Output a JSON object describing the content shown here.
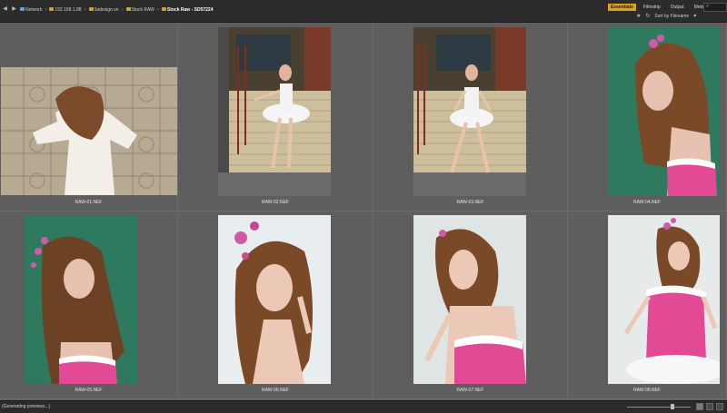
{
  "breadcrumb": {
    "items": [
      {
        "label": "Network",
        "icon": "network-icon"
      },
      {
        "label": "192.168.1.88",
        "icon": "folder-icon"
      },
      {
        "label": "3adesign.vn",
        "icon": "folder-icon"
      },
      {
        "label": "Stock RAW",
        "icon": "folder-icon"
      },
      {
        "label": "Stock Raw - SD57224",
        "icon": "folder-icon"
      }
    ]
  },
  "workspaces": [
    "Essentials",
    "Filmstrip",
    "Output",
    "Metadata"
  ],
  "active_workspace": "Essentials",
  "sort": {
    "label": "Sort by Filename"
  },
  "thumbnails": [
    {
      "filename": "RAW-01.NEF",
      "palette": "tile-wall"
    },
    {
      "filename": "RAW-02.NEF",
      "palette": "brick-ballet"
    },
    {
      "filename": "RAW-03.NEF",
      "palette": "brick-ballet"
    },
    {
      "filename": "RAW-04.NEF",
      "palette": "green-portrait"
    },
    {
      "filename": "RAW-05.NEF",
      "palette": "green-portrait"
    },
    {
      "filename": "RAW-06.NEF",
      "palette": "white-portrait"
    },
    {
      "filename": "RAW-07.NEF",
      "palette": "white-portrait"
    },
    {
      "filename": "RAW-08.NEF",
      "palette": "white-corset"
    }
  ],
  "status": {
    "text": "(Generating previews...)"
  },
  "thumbnail_zoom": 0.72,
  "colors": {
    "accent": "#e0a21a",
    "panel": "#5e5e5e",
    "bar": "#2b2b2b"
  }
}
